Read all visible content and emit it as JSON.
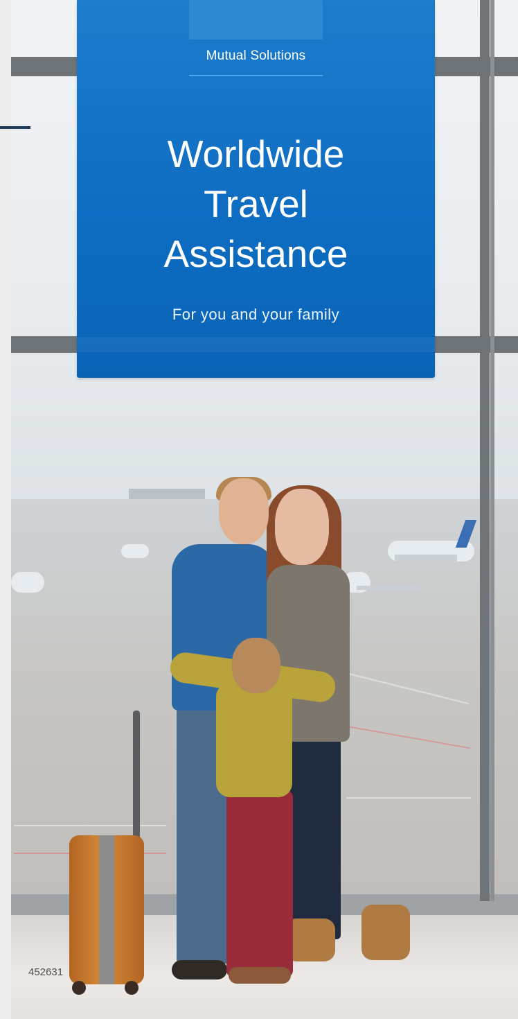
{
  "brand": "Mutual Solutions",
  "title_lines": [
    "Worldwide",
    "Travel",
    "Assistance"
  ],
  "subtitle": "For you and your family",
  "code": "452631",
  "colors": {
    "panel_blue": "#0d6cc1",
    "panel_accent": "#4aa8ee",
    "text_white": "#ffffff"
  }
}
